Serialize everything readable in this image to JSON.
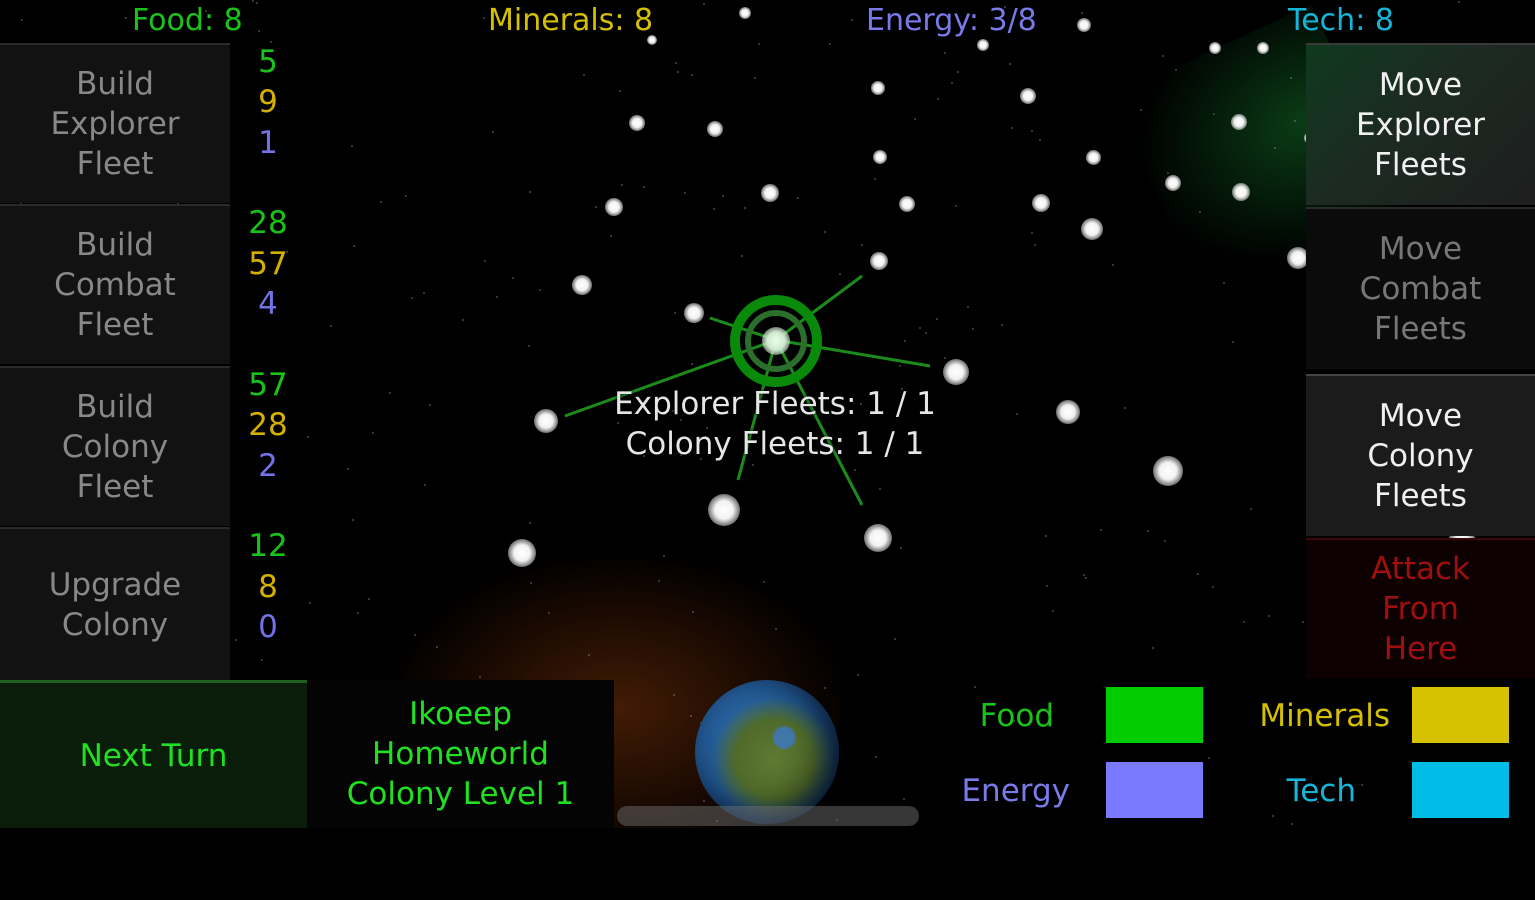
{
  "resources": {
    "food": {
      "label": "Food: 8",
      "color": "#19c419"
    },
    "minerals": {
      "label": "Minerals: 8",
      "color": "#d4c000"
    },
    "energy": {
      "label": "Energy: 3/8",
      "color": "#7a7ae8"
    },
    "tech": {
      "label": "Tech: 8",
      "color": "#13b6d8"
    }
  },
  "build_buttons": [
    {
      "label": "Build Explorer Fleet",
      "lines": [
        "Build",
        "Explorer",
        "Fleet"
      ],
      "costs": {
        "food": "5",
        "minerals": "9",
        "energy": "1"
      }
    },
    {
      "label": "Build Combat Fleet",
      "lines": [
        "Build",
        "Combat",
        "Fleet"
      ],
      "costs": {
        "food": "28",
        "minerals": "57",
        "energy": "4"
      }
    },
    {
      "label": "Build Colony Fleet",
      "lines": [
        "Build",
        "Colony",
        "Fleet"
      ],
      "costs": {
        "food": "57",
        "minerals": "28",
        "energy": "2"
      }
    },
    {
      "label": "Upgrade Colony",
      "lines": [
        "Upgrade",
        "Colony"
      ],
      "costs": {
        "food": "12",
        "minerals": "8",
        "energy": "0"
      }
    }
  ],
  "move_buttons": [
    {
      "lines": [
        "Move",
        "Explorer",
        "Fleets"
      ],
      "state": "enabled"
    },
    {
      "lines": [
        "Move",
        "Combat",
        "Fleets"
      ],
      "state": "disabled"
    },
    {
      "lines": [
        "Move",
        "Colony",
        "Fleets"
      ],
      "state": "enabled"
    },
    {
      "lines": [
        "Attack",
        "From",
        "Here"
      ],
      "state": "disabled"
    }
  ],
  "map": {
    "selected_system": {
      "explorer_fleets": "Explorer Fleets: 1 / 1",
      "colony_fleets": "Colony Fleets: 1 / 1"
    }
  },
  "bottom": {
    "next_turn": "Next Turn",
    "colony": {
      "name": "Ikoeep",
      "type": "Homeworld",
      "level": "Colony Level 1"
    }
  },
  "legend": [
    {
      "label": "Food",
      "color": "#00cc00"
    },
    {
      "label": "Minerals",
      "color": "#d6c200"
    },
    {
      "label": "Energy",
      "color": "#7a7aff"
    },
    {
      "label": "Tech",
      "color": "#00bde8"
    }
  ]
}
